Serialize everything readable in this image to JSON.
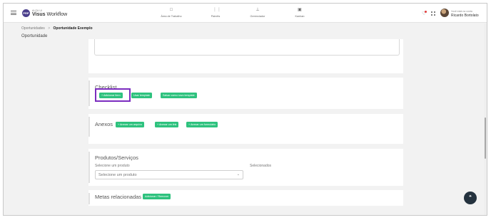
{
  "topbar": {
    "logo_badge": "PRP",
    "logo_small": "ALFA UI",
    "logo_brand": "Visus",
    "logo_product": "Workflow",
    "nav": [
      {
        "icon": "monitor-icon",
        "label": "Área de Trabalho"
      },
      {
        "icon": "bar-chart-icon",
        "label": "Painéis"
      },
      {
        "icon": "manage-icon",
        "label": "Gerenciador"
      },
      {
        "icon": "kanban-icon",
        "label": "Kanban"
      }
    ],
    "account_label": "Você está na conta",
    "account_name": "Ricardo Bortolato"
  },
  "breadcrumb": {
    "parent": "Oportunidades",
    "separator": ">",
    "current": "Oportunidade Exemplo"
  },
  "page_title": "Oportunidade",
  "checklist": {
    "title": "Checklist",
    "add_item": "+ Adicionar Item",
    "use_template": "Usar template",
    "save_template": "Salvar como novo template"
  },
  "anexos": {
    "title": "Anexos",
    "attach_file": "+ Anexar um arquivo",
    "attach_link": "+ Anexar um link",
    "attach_form": "+ Anexar um formulário"
  },
  "produtos": {
    "title": "Produtos/Serviços",
    "select_label": "Selecione um produto",
    "select_placeholder": "Selecione um produto",
    "selected_label": "Selecionados"
  },
  "metas": {
    "title": "Metas relacionadas",
    "button": "Adicionar / Remover"
  },
  "colors": {
    "accent_green": "#2ec27e",
    "highlight_purple": "#7b2cbf",
    "logo_purple": "#4b3f8c",
    "fab_dark": "#24323e"
  }
}
